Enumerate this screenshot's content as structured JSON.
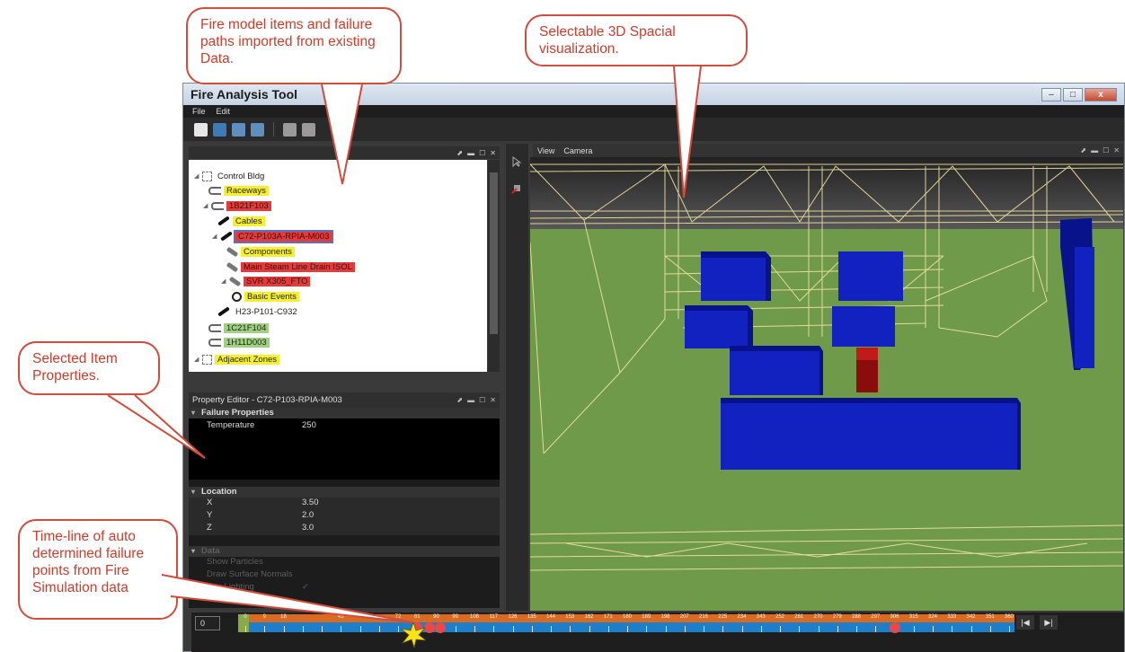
{
  "window": {
    "title": "Fire Analysis Tool",
    "controls": [
      "–",
      "□",
      "x"
    ]
  },
  "menu": [
    "File",
    "Edit"
  ],
  "toolbar_icons": [
    "new-file-icon",
    "open-folder-icon",
    "save-icon",
    "save-as-icon",
    "settings-icon",
    "search-icon"
  ],
  "panel_controls": [
    "⬈",
    "▬",
    "☐",
    "✕"
  ],
  "tree": {
    "items": [
      {
        "label": "Control Bldg",
        "icon": "zone-icon",
        "style": "none"
      },
      {
        "label": "Raceways",
        "icon": "raceway-icon",
        "style": "yellow"
      },
      {
        "label": "1B21F103",
        "icon": "raceway-icon",
        "style": "red"
      },
      {
        "label": "Cables",
        "icon": "cable-icon",
        "style": "yellow"
      },
      {
        "label": "C72-P103A-RPIA-M003",
        "icon": "cable-icon",
        "style": "red-selected"
      },
      {
        "label": "Components",
        "icon": "wrench-icon",
        "style": "yellow"
      },
      {
        "label": "Main Steam Line Drain ISOL",
        "icon": "wrench-icon",
        "style": "red"
      },
      {
        "label": "SVR X305_FTO",
        "icon": "wrench-icon",
        "style": "red"
      },
      {
        "label": "Basic Events",
        "icon": "clock-icon",
        "style": "yellow"
      },
      {
        "label": "H23-P101-C932",
        "icon": "cable-icon",
        "style": "none"
      },
      {
        "label": "1C21F104",
        "icon": "raceway-icon",
        "style": "green"
      },
      {
        "label": "1H11D003",
        "icon": "raceway-icon",
        "style": "green"
      },
      {
        "label": "Adjacent Zones",
        "icon": "zone-icon",
        "style": "yellow"
      }
    ]
  },
  "property_editor": {
    "title": "Property Editor - C72-P103-RPIA-M003",
    "sections": {
      "failure": {
        "label": "Failure Properties",
        "rows": [
          {
            "key": "Temperature",
            "value": "250"
          }
        ]
      },
      "location": {
        "label": "Location",
        "rows": [
          {
            "key": "X",
            "value": "3.50"
          },
          {
            "key": "Y",
            "value": "2.0"
          },
          {
            "key": "Z",
            "value": "3.0"
          }
        ]
      },
      "data": {
        "label": "Data",
        "rows": [
          {
            "key": "Show Particles",
            "value": ""
          },
          {
            "key": "Draw Surface Normals",
            "value": ""
          },
          {
            "key": "Use Lighting",
            "value": "✓"
          }
        ]
      }
    }
  },
  "view": {
    "menu": [
      "View",
      "Camera"
    ]
  },
  "timeline": {
    "current": "0",
    "ticks": [
      "0",
      "9",
      "18",
      "27",
      "36",
      "45",
      "54",
      "63",
      "72",
      "81",
      "90",
      "99",
      "108",
      "117",
      "126",
      "135",
      "144",
      "153",
      "162",
      "171",
      "180",
      "189",
      "198",
      "207",
      "216",
      "225",
      "234",
      "243",
      "252",
      "261",
      "270",
      "279",
      "288",
      "297",
      "306",
      "315",
      "324",
      "333",
      "342",
      "351",
      "360"
    ],
    "visible_labels": [
      "0",
      "9",
      "18",
      "45",
      "72",
      "81",
      "90",
      "99",
      "108",
      "117",
      "126",
      "135",
      "144",
      "153",
      "162",
      "171",
      "180",
      "189",
      "198",
      "207",
      "216",
      "225",
      "234",
      "243",
      "252",
      "261",
      "270",
      "279",
      "288",
      "297",
      "306",
      "315",
      "324",
      "333",
      "342",
      "351",
      "360"
    ],
    "failure_points": [
      81,
      87,
      92,
      306
    ],
    "buttons": [
      "|◀",
      "▶|"
    ]
  },
  "callouts": {
    "fire_model": "Fire model items and failure paths imported from existing Data.",
    "spatial": "Selectable 3D Spacial visualization.",
    "selected": "Selected Item Properties.",
    "timeline": "Time-line of auto determined failure points from Fire Simulation data"
  },
  "colors": {
    "accent_red": "#d23b2a",
    "highlight_yellow": "#f6ef2c",
    "highlight_red": "#e33b3b",
    "highlight_green": "#9fd27e",
    "floor_green": "#6e9a4a",
    "block_blue": "#0a1aa0",
    "block_red": "#9a1010"
  }
}
